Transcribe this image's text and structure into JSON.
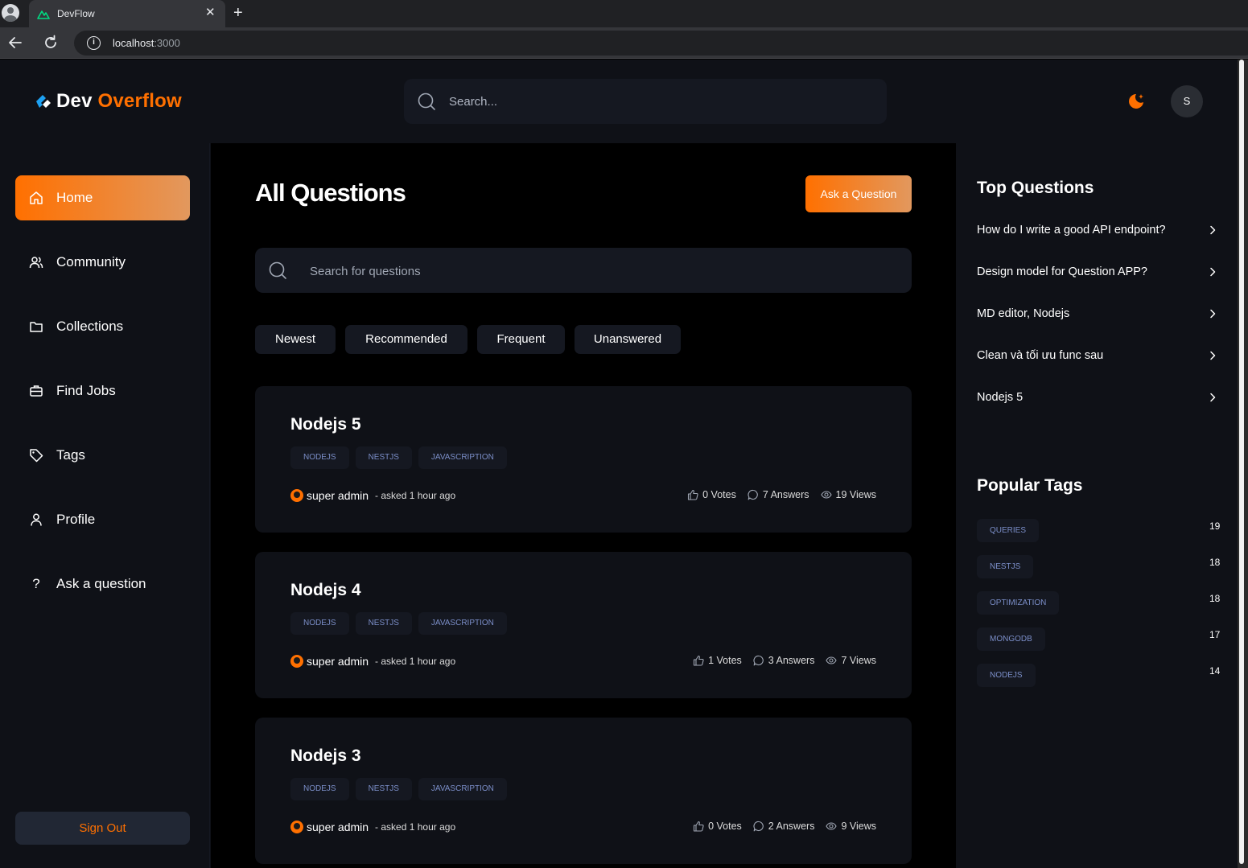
{
  "browser": {
    "tab_title": "DevFlow",
    "url_host": "localhost",
    "url_port": ":3000"
  },
  "header": {
    "logo_dev": "Dev",
    "logo_overflow": "Overflow",
    "search_placeholder": "Search...",
    "avatar_initial": "S"
  },
  "colors": {
    "accent": "#ff7000",
    "background": "#0f1117",
    "card": "#151821",
    "tag_text": "#7b8ec8"
  },
  "sidebar": {
    "items": [
      {
        "label": "Home",
        "icon": "home-icon",
        "active": true
      },
      {
        "label": "Community",
        "icon": "users-icon"
      },
      {
        "label": "Collections",
        "icon": "folder-icon"
      },
      {
        "label": "Find Jobs",
        "icon": "briefcase-icon"
      },
      {
        "label": "Tags",
        "icon": "tag-icon"
      },
      {
        "label": "Profile",
        "icon": "user-icon"
      },
      {
        "label": "Ask a question",
        "icon": "question-icon"
      }
    ],
    "sign_out": "Sign Out"
  },
  "main": {
    "title": "All Questions",
    "ask_button": "Ask a Question",
    "search_placeholder": "Search for questions",
    "filters": [
      "Newest",
      "Recommended",
      "Frequent",
      "Unanswered"
    ],
    "questions": [
      {
        "title": "Nodejs 5",
        "tags": [
          "NODEJS",
          "NESTJS",
          "JAVASCRIPTION"
        ],
        "author": "super admin",
        "asked": "- asked 1 hour ago",
        "votes": "0 Votes",
        "answers": "7 Answers",
        "views": "19 Views"
      },
      {
        "title": "Nodejs 4",
        "tags": [
          "NODEJS",
          "NESTJS",
          "JAVASCRIPTION"
        ],
        "author": "super admin",
        "asked": "- asked 1 hour ago",
        "votes": "1 Votes",
        "answers": "3 Answers",
        "views": "7 Views"
      },
      {
        "title": "Nodejs 3",
        "tags": [
          "NODEJS",
          "NESTJS",
          "JAVASCRIPTION"
        ],
        "author": "super admin",
        "asked": "- asked 1 hour ago",
        "votes": "0 Votes",
        "answers": "2 Answers",
        "views": "9 Views"
      }
    ]
  },
  "right_sidebar": {
    "top_questions_heading": "Top Questions",
    "top_questions": [
      "How do I write a good API endpoint?",
      "Design model for Question APP?",
      "MD editor, Nodejs",
      "Clean và tối ưu func sau",
      "Nodejs 5"
    ],
    "popular_tags_heading": "Popular Tags",
    "popular_tags": [
      {
        "name": "QUERIES",
        "count": "19"
      },
      {
        "name": "NESTJS",
        "count": "18"
      },
      {
        "name": "OPTIMIZATION",
        "count": "18"
      },
      {
        "name": "MONGODB",
        "count": "17"
      },
      {
        "name": "NODEJS",
        "count": "14"
      }
    ]
  }
}
